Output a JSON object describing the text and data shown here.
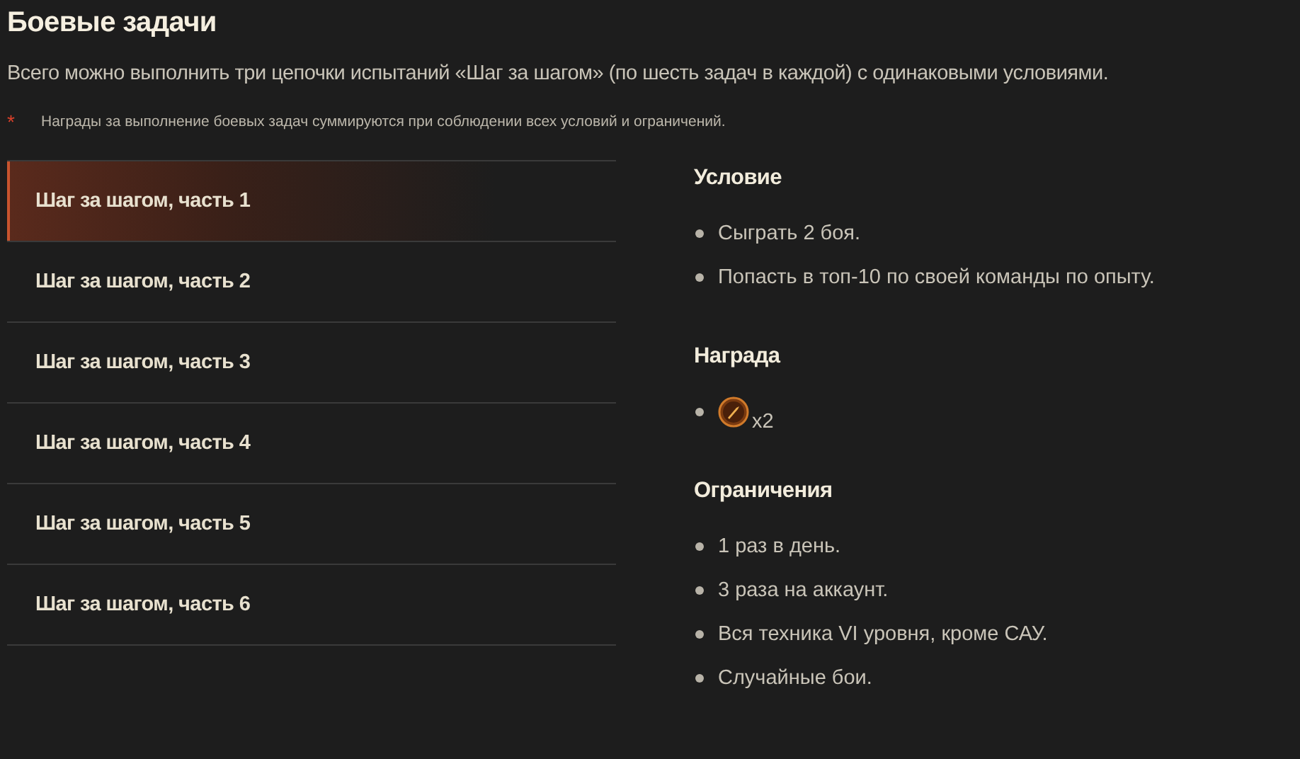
{
  "title": "Боевые задачи",
  "intro": "Всего можно выполнить три цепочки испытаний «Шаг за шагом» (по шесть задач в каждой) с одинаковыми условиями.",
  "note": {
    "mark": "*",
    "text": "Награды за выполнение боевых задач суммируются при соблюдении всех условий и ограничений."
  },
  "tasks": [
    {
      "label": "Шаг за шагом, часть 1",
      "selected": true
    },
    {
      "label": "Шаг за шагом, часть 2",
      "selected": false
    },
    {
      "label": "Шаг за шагом, часть 3",
      "selected": false
    },
    {
      "label": "Шаг за шагом, часть 4",
      "selected": false
    },
    {
      "label": "Шаг за шагом, часть 5",
      "selected": false
    },
    {
      "label": "Шаг за шагом, часть 6",
      "selected": false
    }
  ],
  "sections": [
    {
      "title": "Условие",
      "items": [
        {
          "kind": "text",
          "text": "Сыграть 2 боя."
        },
        {
          "kind": "text",
          "text": "Попасть в топ-10 по своей команды по опыту."
        }
      ]
    },
    {
      "title": "Награда",
      "items": [
        {
          "kind": "reward",
          "text": "x2"
        }
      ]
    },
    {
      "title": "Ограничения",
      "items": [
        {
          "kind": "text",
          "text": "1 раз в день."
        },
        {
          "kind": "text",
          "text": "3 раза на аккаунт."
        },
        {
          "kind": "text",
          "text": "Вся техника VI уровня, кроме САУ."
        },
        {
          "kind": "text",
          "text": "Случайные бои."
        }
      ]
    }
  ]
}
